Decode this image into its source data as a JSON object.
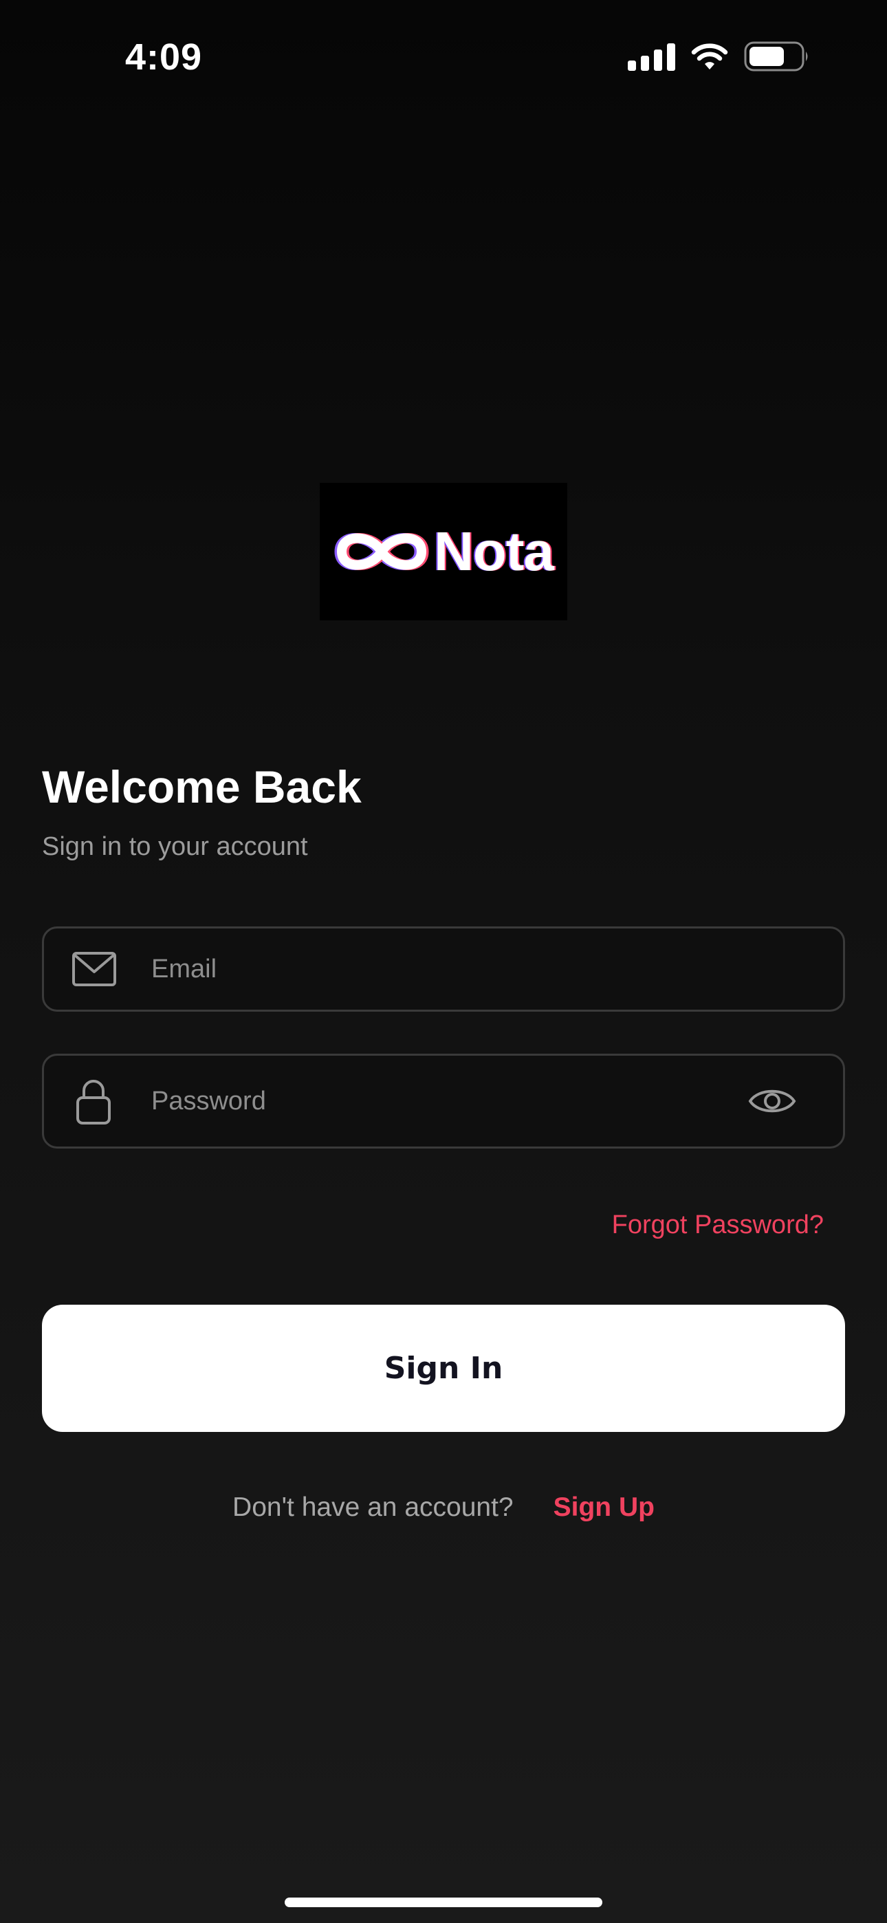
{
  "status_bar": {
    "time": "4:09",
    "signal_icon": "cellular-signal-icon",
    "wifi_icon": "wifi-icon",
    "battery_icon": "battery-icon"
  },
  "logo": {
    "symbol_icon": "infinity-icon",
    "text": "Nota"
  },
  "header": {
    "title": "Welcome Back",
    "subtitle": "Sign in to your account"
  },
  "form": {
    "email": {
      "icon": "envelope-icon",
      "placeholder": "Email",
      "value": ""
    },
    "password": {
      "icon": "lock-icon",
      "placeholder": "Password",
      "value": "",
      "toggle_icon": "eye-icon"
    },
    "forgot_label": "Forgot Password?",
    "submit_label": "Sign In"
  },
  "footer": {
    "prompt": "Don't have an account?",
    "signup_label": "Sign Up"
  },
  "colors": {
    "accent": "#f0425f",
    "button_bg": "#ffffff",
    "button_text": "#131320",
    "placeholder": "#8e8e8e",
    "field_border": "#3a3a3a"
  }
}
